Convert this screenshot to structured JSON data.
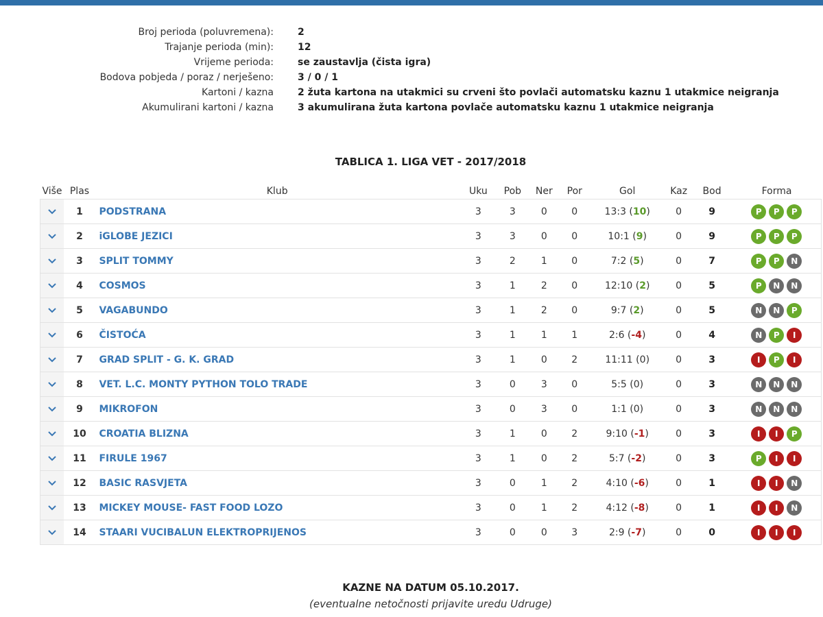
{
  "info": [
    {
      "label": "Broj perioda (poluvremena):",
      "value": "2"
    },
    {
      "label": "Trajanje perioda (min):",
      "value": "12"
    },
    {
      "label": "Vrijeme perioda:",
      "value": "se zaustavlja (čista igra)"
    },
    {
      "label": "Bodova pobjeda / poraz / nerješeno:",
      "value": "3 / 0 / 1"
    },
    {
      "label": "Kartoni / kazna",
      "value": "2 žuta kartona na utakmici su crveni što povlači automatsku kaznu 1 utakmice neigranja"
    },
    {
      "label": "Akumulirani kartoni / kazna",
      "value": "3 akumulirana žuta kartona povlače automatsku kaznu 1 utakmice neigranja"
    }
  ],
  "table_title": "TABLICA 1. LIGA VET - 2017/2018",
  "headers": {
    "more": "Više",
    "pos": "Plas",
    "club": "Klub",
    "played": "Uku",
    "won": "Pob",
    "draw": "Ner",
    "lost": "Por",
    "goals": "Gol",
    "penalty": "Kaz",
    "points": "Bod",
    "form": "Forma"
  },
  "rows": [
    {
      "pos": "1",
      "club": "PODSTRANA",
      "played": "3",
      "won": "3",
      "draw": "0",
      "lost": "0",
      "goals": "13:3",
      "diff": "10",
      "penalty": "0",
      "points": "9",
      "form": [
        "P",
        "P",
        "P"
      ]
    },
    {
      "pos": "2",
      "club": "iGLOBE JEZICI",
      "played": "3",
      "won": "3",
      "draw": "0",
      "lost": "0",
      "goals": "10:1",
      "diff": "9",
      "penalty": "0",
      "points": "9",
      "form": [
        "P",
        "P",
        "P"
      ]
    },
    {
      "pos": "3",
      "club": "SPLIT TOMMY",
      "played": "3",
      "won": "2",
      "draw": "1",
      "lost": "0",
      "goals": "7:2",
      "diff": "5",
      "penalty": "0",
      "points": "7",
      "form": [
        "P",
        "P",
        "N"
      ]
    },
    {
      "pos": "4",
      "club": "COSMOS",
      "played": "3",
      "won": "1",
      "draw": "2",
      "lost": "0",
      "goals": "12:10",
      "diff": "2",
      "penalty": "0",
      "points": "5",
      "form": [
        "P",
        "N",
        "N"
      ]
    },
    {
      "pos": "5",
      "club": "VAGABUNDO",
      "played": "3",
      "won": "1",
      "draw": "2",
      "lost": "0",
      "goals": "9:7",
      "diff": "2",
      "penalty": "0",
      "points": "5",
      "form": [
        "N",
        "N",
        "P"
      ]
    },
    {
      "pos": "6",
      "club": "ČISTOĆA",
      "played": "3",
      "won": "1",
      "draw": "1",
      "lost": "1",
      "goals": "2:6",
      "diff": "-4",
      "penalty": "0",
      "points": "4",
      "form": [
        "N",
        "P",
        "I"
      ]
    },
    {
      "pos": "7",
      "club": "GRAD SPLIT - G. K. GRAD",
      "played": "3",
      "won": "1",
      "draw": "0",
      "lost": "2",
      "goals": "11:11",
      "diff": "0",
      "penalty": "0",
      "points": "3",
      "form": [
        "I",
        "P",
        "I"
      ]
    },
    {
      "pos": "8",
      "club": "VET. L.C. MONTY PYTHON TOLO TRADE",
      "played": "3",
      "won": "0",
      "draw": "3",
      "lost": "0",
      "goals": "5:5",
      "diff": "0",
      "penalty": "0",
      "points": "3",
      "form": [
        "N",
        "N",
        "N"
      ]
    },
    {
      "pos": "9",
      "club": "MIKROFON",
      "played": "3",
      "won": "0",
      "draw": "3",
      "lost": "0",
      "goals": "1:1",
      "diff": "0",
      "penalty": "0",
      "points": "3",
      "form": [
        "N",
        "N",
        "N"
      ]
    },
    {
      "pos": "10",
      "club": "CROATIA BLIZNA",
      "played": "3",
      "won": "1",
      "draw": "0",
      "lost": "2",
      "goals": "9:10",
      "diff": "-1",
      "penalty": "0",
      "points": "3",
      "form": [
        "I",
        "I",
        "P"
      ]
    },
    {
      "pos": "11",
      "club": "FIRULE 1967",
      "played": "3",
      "won": "1",
      "draw": "0",
      "lost": "2",
      "goals": "5:7",
      "diff": "-2",
      "penalty": "0",
      "points": "3",
      "form": [
        "P",
        "I",
        "I"
      ]
    },
    {
      "pos": "12",
      "club": "BASIC RASVJETA",
      "played": "3",
      "won": "0",
      "draw": "1",
      "lost": "2",
      "goals": "4:10",
      "diff": "-6",
      "penalty": "0",
      "points": "1",
      "form": [
        "I",
        "I",
        "N"
      ]
    },
    {
      "pos": "13",
      "club": "MICKEY MOUSE- FAST FOOD LOZO",
      "played": "3",
      "won": "0",
      "draw": "1",
      "lost": "2",
      "goals": "4:12",
      "diff": "-8",
      "penalty": "0",
      "points": "1",
      "form": [
        "I",
        "I",
        "N"
      ]
    },
    {
      "pos": "14",
      "club": "STAARI VUCIBALUN ELEKTROPRIJENOS",
      "played": "3",
      "won": "0",
      "draw": "0",
      "lost": "3",
      "goals": "2:9",
      "diff": "-7",
      "penalty": "0",
      "points": "0",
      "form": [
        "I",
        "I",
        "I"
      ]
    }
  ],
  "fines_title": "KAZNE NA DATUM 05.10.2017.",
  "fines_note": "(eventualne netočnosti prijavite uredu Udruge)",
  "colors": {
    "accent": "#2f6fa8",
    "club_link": "#3a78b5",
    "win": "#6aaa2b",
    "draw": "#6b6b6b",
    "loss": "#b51c1c"
  }
}
